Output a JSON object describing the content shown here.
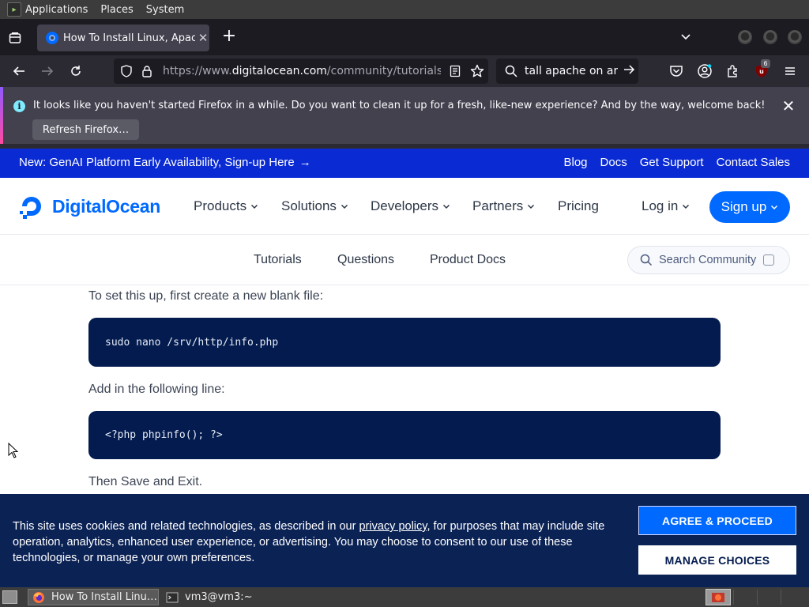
{
  "top_panel": {
    "menus": [
      "Applications",
      "Places",
      "System"
    ]
  },
  "browser": {
    "tab": {
      "title": "How To Install Linux, Apache",
      "close_glyph": "✕"
    },
    "new_tab_glyph": "+",
    "url": {
      "prefix": "https://www.",
      "host": "digitalocean.com",
      "path": "/community/tutorials/how"
    },
    "search_value": "tall apache on arch",
    "extension_badge": "6",
    "notification": {
      "message": "It looks like you haven't started Firefox in a while. Do you want to clean it up for a fresh, like-new experience? And by the way, welcome back!",
      "button": "Refresh Firefox…",
      "info_glyph": "i",
      "close_glyph": "✕"
    }
  },
  "site": {
    "promo": {
      "text": "New: GenAI Platform Early Availability, Sign-up Here",
      "arrow": "→",
      "links": [
        "Blog",
        "Docs",
        "Get Support",
        "Contact Sales"
      ]
    },
    "logo_text": "DigitalOcean",
    "nav": [
      {
        "label": "Products",
        "has_menu": true
      },
      {
        "label": "Solutions",
        "has_menu": true
      },
      {
        "label": "Developers",
        "has_menu": true
      },
      {
        "label": "Partners",
        "has_menu": true
      },
      {
        "label": "Pricing",
        "has_menu": false
      }
    ],
    "login": "Log in",
    "signup": "Sign up",
    "chevron_glyph": "⌄",
    "subnav": [
      "Tutorials",
      "Questions",
      "Product Docs"
    ],
    "search_placeholder": "Search Community",
    "brand_color": "#0069ff"
  },
  "article": {
    "para1": "To set this up, first create a new blank file:",
    "code1": "sudo nano /srv/http/info.php",
    "para2": "Add in the following line:",
    "code2": "<?php phpinfo(); ?>",
    "para3": "Then Save and Exit."
  },
  "cookie": {
    "text_before": "This site uses cookies and related technologies, as described in our ",
    "link": "privacy policy",
    "text_after": ", for purposes that may include site operation, analytics, enhanced user experience, or advertising. You may choose to consent to our use of these technologies, or manage your own preferences.",
    "agree": "AGREE & PROCEED",
    "manage": "MANAGE CHOICES"
  },
  "taskbar": {
    "tasks": [
      "How To Install Linu…",
      "vm3@vm3:~"
    ]
  }
}
